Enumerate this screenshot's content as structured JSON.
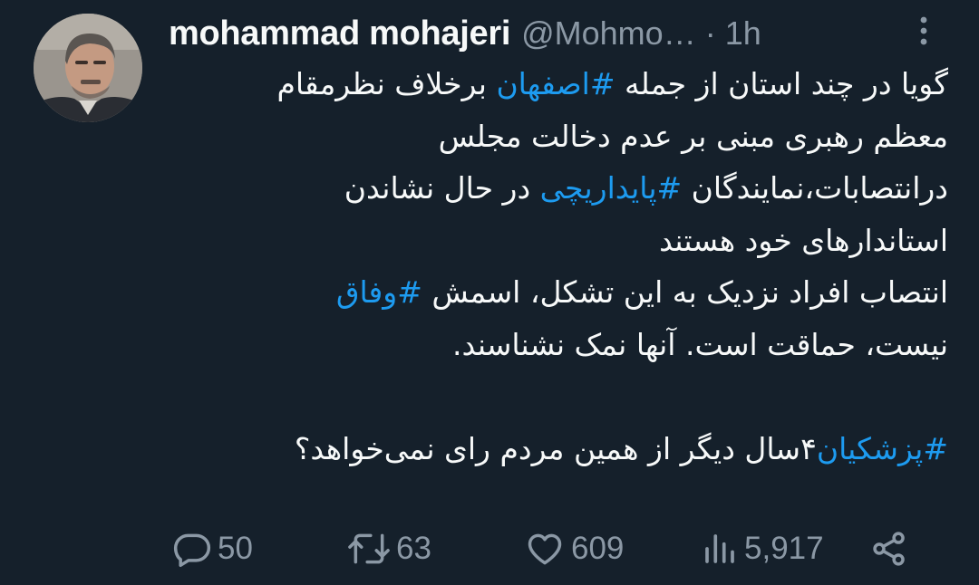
{
  "author": {
    "display_name": "mohammad mohajeri",
    "handle": "@Mohmo…",
    "separator": "·",
    "time": "1h"
  },
  "tweet": {
    "lines": [
      {
        "segments": [
          {
            "text": "گویا در چند استان از جمله ",
            "tag": false
          },
          {
            "text": "#اصفهان",
            "tag": true
          },
          {
            "text": " برخلاف نظرمقام",
            "tag": false
          }
        ]
      },
      {
        "segments": [
          {
            "text": "معظم رهبری مبنی بر عدم دخالت مجلس",
            "tag": false
          }
        ]
      },
      {
        "segments": [
          {
            "text": "درانتصابات،نمایندگان ",
            "tag": false
          },
          {
            "text": "#پایداریچی",
            "tag": true
          },
          {
            "text": " در حال نشاندن",
            "tag": false
          }
        ]
      },
      {
        "segments": [
          {
            "text": "استاندارهای خود هستند",
            "tag": false
          }
        ]
      },
      {
        "segments": [
          {
            "text": " انتصاب افراد  نزدیک به این تشکل، اسمش ",
            "tag": false
          },
          {
            "text": "#وفاق",
            "tag": true
          }
        ]
      },
      {
        "segments": [
          {
            "text": "نیست، حماقت است. آنها نمک نشناسند.",
            "tag": false
          }
        ]
      },
      {
        "segments": []
      },
      {
        "segments": [
          {
            "text": "#پزشکیان",
            "tag": true
          },
          {
            "text": "۴سال دیگر از همین مردم رای نمی‌خواهد؟",
            "tag": false
          }
        ]
      }
    ]
  },
  "actions": {
    "replies": "50",
    "retweets": "63",
    "likes": "609",
    "views": "5,917"
  },
  "icons": {
    "more": "more-vertical-icon",
    "reply": "reply-icon",
    "retweet": "retweet-icon",
    "like": "heart-icon",
    "views": "views-chart-icon",
    "share": "share-icon"
  },
  "colors": {
    "background": "#15202b",
    "text": "#f7f9f9",
    "secondary": "#8b98a5",
    "hashtag": "#1d9bf0"
  }
}
